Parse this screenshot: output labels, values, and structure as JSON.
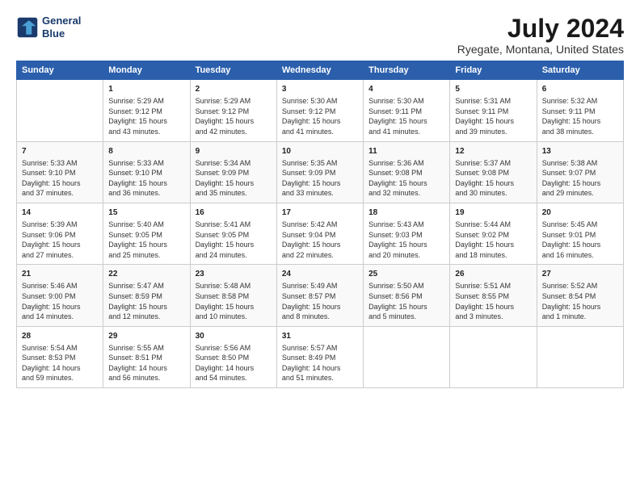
{
  "header": {
    "logo_line1": "General",
    "logo_line2": "Blue",
    "title": "July 2024",
    "subtitle": "Ryegate, Montana, United States"
  },
  "days_of_week": [
    "Sunday",
    "Monday",
    "Tuesday",
    "Wednesday",
    "Thursday",
    "Friday",
    "Saturday"
  ],
  "weeks": [
    [
      {
        "day": "",
        "content": ""
      },
      {
        "day": "1",
        "content": "Sunrise: 5:29 AM\nSunset: 9:12 PM\nDaylight: 15 hours\nand 43 minutes."
      },
      {
        "day": "2",
        "content": "Sunrise: 5:29 AM\nSunset: 9:12 PM\nDaylight: 15 hours\nand 42 minutes."
      },
      {
        "day": "3",
        "content": "Sunrise: 5:30 AM\nSunset: 9:12 PM\nDaylight: 15 hours\nand 41 minutes."
      },
      {
        "day": "4",
        "content": "Sunrise: 5:30 AM\nSunset: 9:11 PM\nDaylight: 15 hours\nand 41 minutes."
      },
      {
        "day": "5",
        "content": "Sunrise: 5:31 AM\nSunset: 9:11 PM\nDaylight: 15 hours\nand 39 minutes."
      },
      {
        "day": "6",
        "content": "Sunrise: 5:32 AM\nSunset: 9:11 PM\nDaylight: 15 hours\nand 38 minutes."
      }
    ],
    [
      {
        "day": "7",
        "content": "Sunrise: 5:33 AM\nSunset: 9:10 PM\nDaylight: 15 hours\nand 37 minutes."
      },
      {
        "day": "8",
        "content": "Sunrise: 5:33 AM\nSunset: 9:10 PM\nDaylight: 15 hours\nand 36 minutes."
      },
      {
        "day": "9",
        "content": "Sunrise: 5:34 AM\nSunset: 9:09 PM\nDaylight: 15 hours\nand 35 minutes."
      },
      {
        "day": "10",
        "content": "Sunrise: 5:35 AM\nSunset: 9:09 PM\nDaylight: 15 hours\nand 33 minutes."
      },
      {
        "day": "11",
        "content": "Sunrise: 5:36 AM\nSunset: 9:08 PM\nDaylight: 15 hours\nand 32 minutes."
      },
      {
        "day": "12",
        "content": "Sunrise: 5:37 AM\nSunset: 9:08 PM\nDaylight: 15 hours\nand 30 minutes."
      },
      {
        "day": "13",
        "content": "Sunrise: 5:38 AM\nSunset: 9:07 PM\nDaylight: 15 hours\nand 29 minutes."
      }
    ],
    [
      {
        "day": "14",
        "content": "Sunrise: 5:39 AM\nSunset: 9:06 PM\nDaylight: 15 hours\nand 27 minutes."
      },
      {
        "day": "15",
        "content": "Sunrise: 5:40 AM\nSunset: 9:05 PM\nDaylight: 15 hours\nand 25 minutes."
      },
      {
        "day": "16",
        "content": "Sunrise: 5:41 AM\nSunset: 9:05 PM\nDaylight: 15 hours\nand 24 minutes."
      },
      {
        "day": "17",
        "content": "Sunrise: 5:42 AM\nSunset: 9:04 PM\nDaylight: 15 hours\nand 22 minutes."
      },
      {
        "day": "18",
        "content": "Sunrise: 5:43 AM\nSunset: 9:03 PM\nDaylight: 15 hours\nand 20 minutes."
      },
      {
        "day": "19",
        "content": "Sunrise: 5:44 AM\nSunset: 9:02 PM\nDaylight: 15 hours\nand 18 minutes."
      },
      {
        "day": "20",
        "content": "Sunrise: 5:45 AM\nSunset: 9:01 PM\nDaylight: 15 hours\nand 16 minutes."
      }
    ],
    [
      {
        "day": "21",
        "content": "Sunrise: 5:46 AM\nSunset: 9:00 PM\nDaylight: 15 hours\nand 14 minutes."
      },
      {
        "day": "22",
        "content": "Sunrise: 5:47 AM\nSunset: 8:59 PM\nDaylight: 15 hours\nand 12 minutes."
      },
      {
        "day": "23",
        "content": "Sunrise: 5:48 AM\nSunset: 8:58 PM\nDaylight: 15 hours\nand 10 minutes."
      },
      {
        "day": "24",
        "content": "Sunrise: 5:49 AM\nSunset: 8:57 PM\nDaylight: 15 hours\nand 8 minutes."
      },
      {
        "day": "25",
        "content": "Sunrise: 5:50 AM\nSunset: 8:56 PM\nDaylight: 15 hours\nand 5 minutes."
      },
      {
        "day": "26",
        "content": "Sunrise: 5:51 AM\nSunset: 8:55 PM\nDaylight: 15 hours\nand 3 minutes."
      },
      {
        "day": "27",
        "content": "Sunrise: 5:52 AM\nSunset: 8:54 PM\nDaylight: 15 hours\nand 1 minute."
      }
    ],
    [
      {
        "day": "28",
        "content": "Sunrise: 5:54 AM\nSunset: 8:53 PM\nDaylight: 14 hours\nand 59 minutes."
      },
      {
        "day": "29",
        "content": "Sunrise: 5:55 AM\nSunset: 8:51 PM\nDaylight: 14 hours\nand 56 minutes."
      },
      {
        "day": "30",
        "content": "Sunrise: 5:56 AM\nSunset: 8:50 PM\nDaylight: 14 hours\nand 54 minutes."
      },
      {
        "day": "31",
        "content": "Sunrise: 5:57 AM\nSunset: 8:49 PM\nDaylight: 14 hours\nand 51 minutes."
      },
      {
        "day": "",
        "content": ""
      },
      {
        "day": "",
        "content": ""
      },
      {
        "day": "",
        "content": ""
      }
    ]
  ]
}
